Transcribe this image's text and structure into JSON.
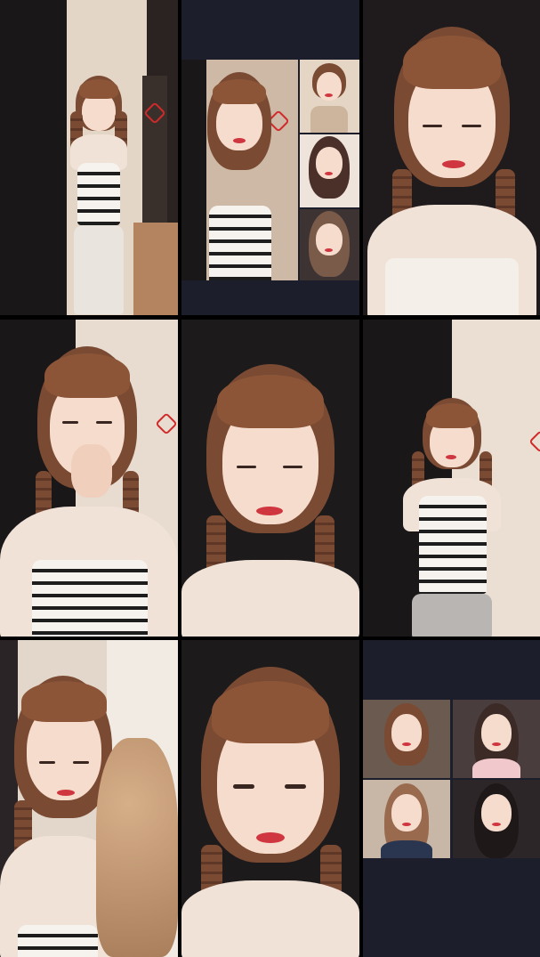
{
  "screen": {
    "background": "#000000",
    "placeholder_tile_color": "#1c1e2b",
    "tiles": [
      {
        "id": "tile-1",
        "scene": "standing-striped-top-doorway"
      },
      {
        "id": "tile-2",
        "scene": "multi-guest-call-panel"
      },
      {
        "id": "tile-3",
        "scene": "closeup-eyes-closed"
      },
      {
        "id": "tile-4",
        "scene": "hand-near-face-striped-top"
      },
      {
        "id": "tile-5",
        "scene": "closeup-smiling-eyes-closed"
      },
      {
        "id": "tile-6",
        "scene": "holding-braids-striped-top"
      },
      {
        "id": "tile-7",
        "scene": "with-cat"
      },
      {
        "id": "tile-8",
        "scene": "closeup-facing-camera"
      },
      {
        "id": "tile-9",
        "scene": "four-guest-call-panel"
      }
    ]
  },
  "colors": {
    "hair": "#7a4a33",
    "skin": "#f6dccd",
    "lips": "#d0363f",
    "door": "#1a1718",
    "wall": "#d9cbbb",
    "accent_seal": "#d02a2a"
  }
}
